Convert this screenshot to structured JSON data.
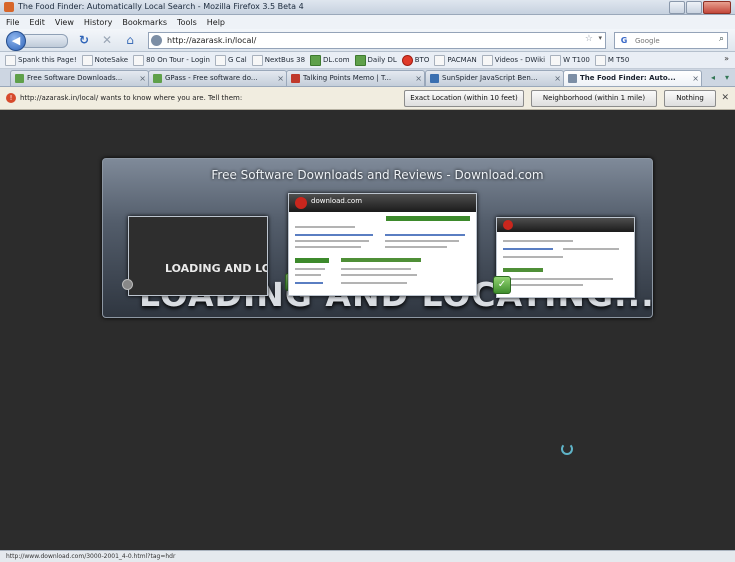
{
  "window": {
    "title": "The Food Finder: Automatically Local Search - Mozilla Firefox 3.5 Beta 4"
  },
  "menu": [
    "File",
    "Edit",
    "View",
    "History",
    "Bookmarks",
    "Tools",
    "Help"
  ],
  "nav": {
    "url": "http://azarask.in/local/",
    "search_placeholder": "Google"
  },
  "bookmarks": [
    {
      "label": "Spank this Page!",
      "icon": "page"
    },
    {
      "label": "NoteSake",
      "icon": "page"
    },
    {
      "label": "80 On Tour - Login",
      "icon": "page"
    },
    {
      "label": "G Cal",
      "icon": "page"
    },
    {
      "label": "NextBus 38",
      "icon": "page"
    },
    {
      "label": "DL.com",
      "icon": "green"
    },
    {
      "label": "Daily DL",
      "icon": "green"
    },
    {
      "label": "BTO",
      "icon": "red"
    },
    {
      "label": "PACMAN",
      "icon": "page"
    },
    {
      "label": "Videos - DWiki",
      "icon": "page"
    },
    {
      "label": "W T100",
      "icon": "page"
    },
    {
      "label": "M T50",
      "icon": "page"
    }
  ],
  "bookmarks_overflow": "»",
  "tabs": [
    {
      "label": "Free Software Downloads..."
    },
    {
      "label": "GPass - Free software do..."
    },
    {
      "label": "Talking Points Memo | T..."
    },
    {
      "label": "SunSpider JavaScript Ben..."
    },
    {
      "label": "The Food Finder: Auto..."
    }
  ],
  "geo": {
    "message": "http://azarask.in/local/ wants to know where you are. Tell them:",
    "exact_label": "Exact Location (within 10 feet)",
    "neighborhood_label": "Neighborhood (within 1 mile)",
    "nothing_label": "Nothing"
  },
  "switcher": {
    "title": "Free Software Downloads and Reviews - Download.com",
    "loading_big": "LOADING AND LOCATING...",
    "loading_small": "LOADING AND LO"
  },
  "status": {
    "text": "http://www.download.com/3000-2001_4-0.html?tag=hdr"
  },
  "colors": {
    "content_bg": "#2c2c2c",
    "accent_green": "#3d8a2c",
    "spinner": "#5fb4c8"
  }
}
